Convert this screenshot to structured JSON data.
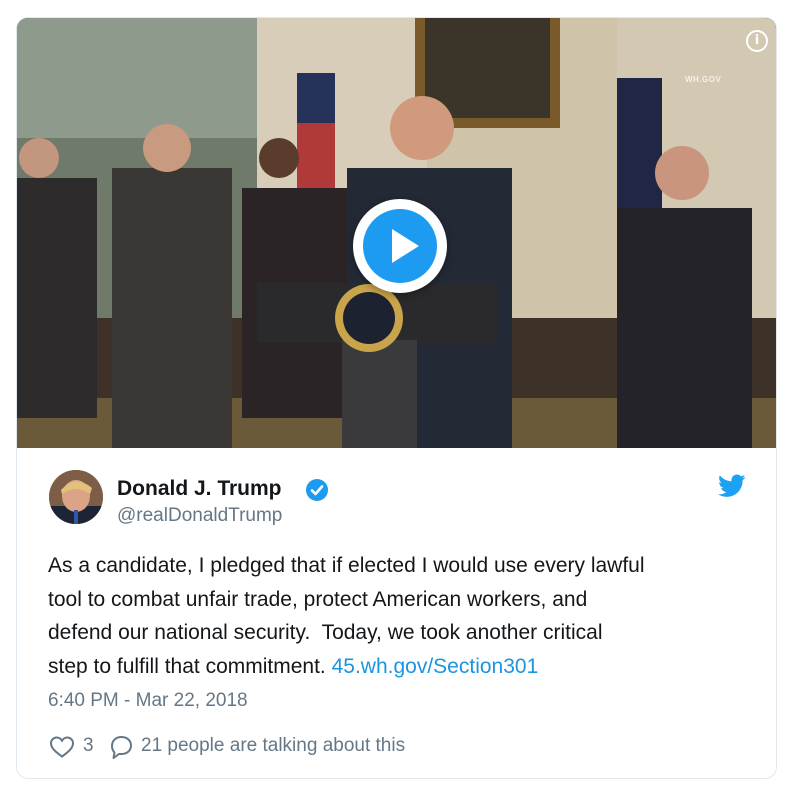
{
  "media": {
    "watermark": "WH.GOV",
    "play_icon": "play-icon",
    "info_icon": "info-icon",
    "info_glyph": "i"
  },
  "tweet": {
    "author_name": "Donald J. Trump",
    "handle": "@realDonaldTrump",
    "text": "As a candidate, I pledged that if elected I would use every lawful\ntool to combat unfair trade, protect American workers, and\ndefend our national security.  Today, we took another critical\nstep to fulfill that commitment. ",
    "link_text": "45.wh.gov/Section301",
    "timestamp": "6:40 PM - Mar 22, 2018",
    "like_count": "3",
    "talking_text": "21 people are talking about this"
  },
  "colors": {
    "accent": "#1b95e0",
    "verified": "#1d9bf0",
    "text": "#14171a",
    "muted": "#657786",
    "border": "#e1e8ed"
  }
}
